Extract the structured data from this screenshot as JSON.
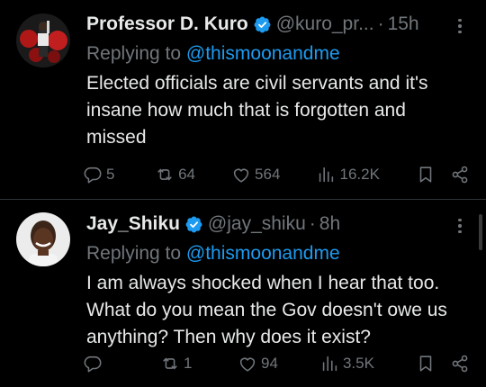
{
  "tweets": [
    {
      "name": "Professor D. Kuro",
      "handle": "@kuro_pr...",
      "dot": "·",
      "time": "15h",
      "replying_prefix": "Replying to ",
      "replying_to": "@thismoonandme",
      "body": "Elected officials are civil servants and it's insane how much that is forgotten and missed",
      "replies": "5",
      "retweets": "64",
      "likes": "564",
      "views": "16.2K"
    },
    {
      "name": "Jay_Shiku",
      "handle": "@jay_shiku",
      "dot": "·",
      "time": "8h",
      "replying_prefix": "Replying to ",
      "replying_to": "@thismoonandme",
      "body": "I am always shocked when I hear that too. What do you mean the Gov doesn't owe us anything? Then why does it exist?",
      "replies": "",
      "retweets": "1",
      "likes": "94",
      "views": "3.5K"
    }
  ],
  "colors": {
    "background": "#000000",
    "text": "#e7e9ea",
    "muted": "#71767b",
    "link": "#1d9bf0",
    "verified": "#1d9bf0",
    "divider": "#2f3336"
  },
  "icons": [
    "verified-badge-icon",
    "more-icon",
    "reply-icon",
    "retweet-icon",
    "like-icon",
    "views-icon",
    "bookmark-icon",
    "share-icon"
  ]
}
